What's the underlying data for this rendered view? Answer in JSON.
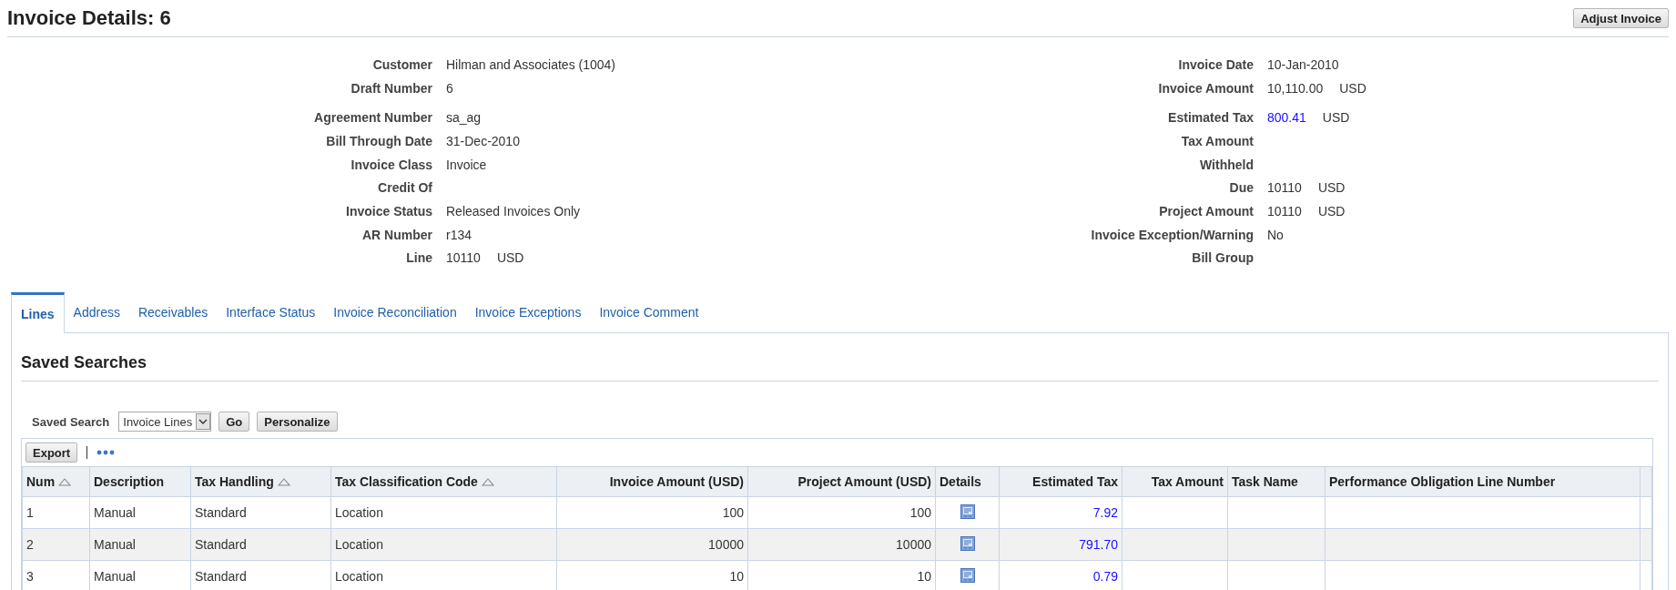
{
  "title": "Invoice Details: 6",
  "adjust_button": "Adjust Invoice",
  "details_left": [
    [
      {
        "label": "Customer",
        "value": "Hilman and Associates (1004)"
      },
      {
        "label": "Draft Number",
        "value": "6"
      }
    ],
    [
      {
        "label": "Agreement Number",
        "value": "sa_ag"
      },
      {
        "label": "Bill Through Date",
        "value": "31-Dec-2010"
      },
      {
        "label": "Invoice Class",
        "value": "Invoice"
      },
      {
        "label": "Credit Of"
      },
      {
        "label": "Invoice Status",
        "value": "Released Invoices Only"
      },
      {
        "label": "AR Number",
        "value": "r134"
      },
      {
        "label": "Line",
        "value": "10110",
        "currency": "USD"
      }
    ]
  ],
  "details_right": [
    [
      {
        "label": "Invoice Date",
        "value": "10-Jan-2010"
      },
      {
        "label": "Invoice Amount",
        "value": "10,110.00",
        "currency": "USD"
      }
    ],
    [
      {
        "label": "Estimated Tax",
        "value": "800.41",
        "link": true,
        "currency": "USD"
      },
      {
        "label": "Tax Amount"
      },
      {
        "label": "Withheld"
      },
      {
        "label": "Due",
        "value": "10110",
        "currency": "USD"
      },
      {
        "label": "Project Amount",
        "value": "10110",
        "currency": "USD"
      },
      {
        "label": "Invoice Exception/Warning",
        "value": "No"
      },
      {
        "label": "Bill Group"
      }
    ]
  ],
  "tabs": [
    {
      "label": "Lines",
      "selected": true
    },
    {
      "label": "Address",
      "selected": false
    },
    {
      "label": "Receivables",
      "selected": false
    },
    {
      "label": "Interface Status",
      "selected": false
    },
    {
      "label": "Invoice Reconciliation",
      "selected": false
    },
    {
      "label": "Invoice Exceptions",
      "selected": false
    },
    {
      "label": "Invoice Comment",
      "selected": false
    }
  ],
  "section_title": "Saved Searches",
  "saved_search": {
    "label": "Saved Search",
    "value": "Invoice Lines",
    "go": "Go",
    "personalize": "Personalize"
  },
  "export_button": "Export",
  "table": {
    "columns": [
      {
        "label": "Num",
        "sortable": true,
        "kind": "text"
      },
      {
        "label": "Description",
        "sortable": false,
        "kind": "text"
      },
      {
        "label": "Tax Handling",
        "sortable": true,
        "kind": "text"
      },
      {
        "label": "Tax Classification Code",
        "sortable": true,
        "kind": "text"
      },
      {
        "label": "Invoice Amount (USD)",
        "sortable": false,
        "kind": "number"
      },
      {
        "label": "Project Amount (USD)",
        "sortable": false,
        "kind": "number"
      },
      {
        "label": "Details",
        "sortable": false,
        "kind": "icon"
      },
      {
        "label": "Estimated Tax",
        "sortable": false,
        "kind": "link"
      },
      {
        "label": "Tax Amount",
        "sortable": false,
        "kind": "number"
      },
      {
        "label": "Task Name",
        "sortable": false,
        "kind": "text"
      },
      {
        "label": "Performance Obligation Line Number",
        "sortable": false,
        "kind": "text"
      }
    ],
    "rows": [
      {
        "cells": [
          "1",
          "Manual",
          "Standard",
          "Location",
          "100",
          "100",
          null,
          "7.92",
          null,
          null,
          null
        ]
      },
      {
        "cells": [
          "2",
          "Manual",
          "Standard",
          "Location",
          "10000",
          "10000",
          null,
          "791.70",
          null,
          null,
          null
        ]
      },
      {
        "cells": [
          "3",
          "Manual",
          "Standard",
          "Location",
          "10",
          "10",
          null,
          "0.79",
          null,
          null,
          null
        ]
      }
    ]
  }
}
